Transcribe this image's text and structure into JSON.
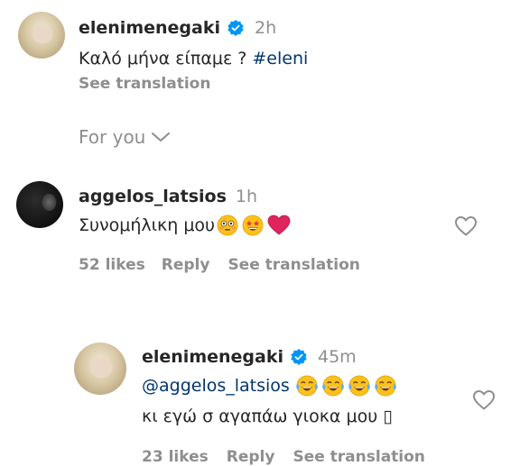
{
  "comments": [
    {
      "username": "elenimenegaki",
      "time": "2h",
      "text": "Καλό μήνα είπαμε ? ",
      "hashtag": "#eleni",
      "see_translation": "See translation"
    },
    {
      "username": "aggelos_latsios",
      "time": "1h",
      "text": "Συνομήλικη μου",
      "emojis": [
        "flushed-face",
        "star-struck-face",
        "red-heart"
      ],
      "likes": "52 likes",
      "reply": "Reply",
      "see_translation": "See translation"
    },
    {
      "username": "elenimenegaki",
      "time": "45m",
      "mention": "@aggelos_latsios",
      "emojis": [
        "tears-of-joy-face",
        "tears-of-joy-face",
        "tears-of-joy-face",
        "tears-of-joy-face"
      ],
      "text2": "κι εγώ σ αγαπάω γιοκα μου ▯",
      "likes": "23 likes",
      "reply": "Reply",
      "see_translation": "See translation"
    }
  ],
  "for_you": "For you",
  "colors": {
    "verified": "#0095f6",
    "heart": "#e0245e",
    "muted": "#8e8e8e",
    "link": "#00376b"
  }
}
